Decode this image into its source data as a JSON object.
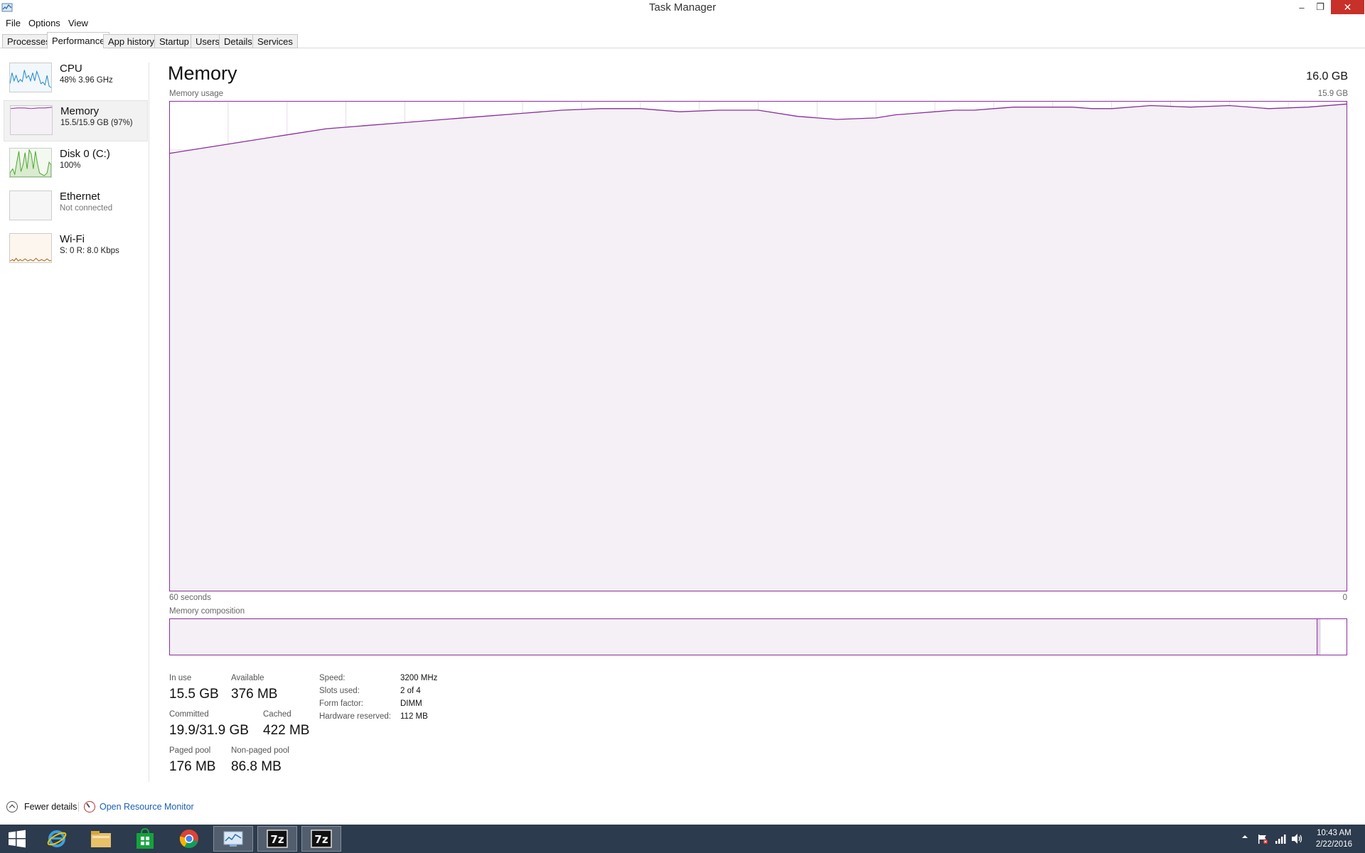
{
  "window": {
    "title": "Task Manager",
    "controls": {
      "minimize": "–",
      "restore": "❐",
      "close": "✕"
    }
  },
  "menu": {
    "file": "File",
    "options": "Options",
    "view": "View"
  },
  "tabs": {
    "processes": "Processes",
    "performance": "Performance",
    "app_history": "App history",
    "startup": "Startup",
    "users": "Users",
    "details": "Details",
    "services": "Services",
    "active": "Performance"
  },
  "sidebar": {
    "cpu": {
      "name": "CPU",
      "sub": "48%  3.96 GHz",
      "color": "#1a87c9"
    },
    "memory": {
      "name": "Memory",
      "sub": "15.5/15.9 GB (97%)",
      "color": "#8b2d9e"
    },
    "disk": {
      "name": "Disk 0 (C:)",
      "sub": "100%",
      "color": "#4da32f"
    },
    "ethernet": {
      "name": "Ethernet",
      "sub": "Not connected"
    },
    "wifi": {
      "name": "Wi-Fi",
      "sub": "S: 0  R: 8.0 Kbps",
      "color": "#a8610a"
    }
  },
  "main": {
    "title": "Memory",
    "total": "16.0 GB",
    "graph_label": "Memory usage",
    "graph_max": "15.9 GB",
    "time_left": "60 seconds",
    "time_right": "0",
    "composition_label": "Memory composition"
  },
  "chart_data": {
    "type": "line",
    "title": "Memory usage",
    "x": [
      60,
      58,
      56,
      54,
      52,
      50,
      48,
      46,
      44,
      42,
      40,
      38,
      36,
      34,
      32,
      31,
      30,
      28,
      26,
      24,
      23,
      22,
      21,
      20,
      19,
      18,
      17,
      16,
      15,
      14,
      13,
      12,
      10,
      8,
      6,
      4,
      2,
      0
    ],
    "values": [
      14.2,
      14.4,
      14.6,
      14.8,
      15.0,
      15.1,
      15.2,
      15.3,
      15.4,
      15.5,
      15.6,
      15.65,
      15.65,
      15.55,
      15.6,
      15.6,
      15.6,
      15.4,
      15.3,
      15.35,
      15.45,
      15.5,
      15.55,
      15.6,
      15.6,
      15.65,
      15.7,
      15.7,
      15.7,
      15.7,
      15.65,
      15.65,
      15.75,
      15.7,
      15.75,
      15.65,
      15.7,
      15.8
    ],
    "xlabel": "60 seconds",
    "ylim": [
      0,
      15.9
    ],
    "grid": true,
    "color": "#8b2d9e",
    "fill": "#f4f0f5"
  },
  "composition": {
    "in_use_fraction": 0.975,
    "modified_fraction": 0.003,
    "standby_fraction": 0.0
  },
  "stats": {
    "in_use": {
      "label": "In use",
      "value": "15.5 GB"
    },
    "available": {
      "label": "Available",
      "value": "376 MB"
    },
    "committed": {
      "label": "Committed",
      "value": "19.9/31.9 GB"
    },
    "cached": {
      "label": "Cached",
      "value": "422 MB"
    },
    "paged_pool": {
      "label": "Paged pool",
      "value": "176 MB"
    },
    "nonpaged_pool": {
      "label": "Non-paged pool",
      "value": "86.8 MB"
    }
  },
  "hardware": {
    "speed": {
      "label": "Speed:",
      "value": "3200 MHz"
    },
    "slots": {
      "label": "Slots used:",
      "value": "2 of 4"
    },
    "form": {
      "label": "Form factor:",
      "value": "DIMM"
    },
    "reserved": {
      "label": "Hardware reserved:",
      "value": "112 MB"
    }
  },
  "footer": {
    "fewer_details": "Fewer details",
    "open_resource_monitor": "Open Resource Monitor"
  },
  "taskbar": {
    "apps": [
      "start-icon",
      "internet-explorer-icon",
      "file-explorer-icon",
      "store-icon",
      "chrome-icon",
      "task-manager-icon",
      "7zip-icon",
      "7zip-icon"
    ],
    "sevenzip_label": "7z",
    "clock_time": "10:43 AM",
    "clock_date": "2/22/2016"
  }
}
